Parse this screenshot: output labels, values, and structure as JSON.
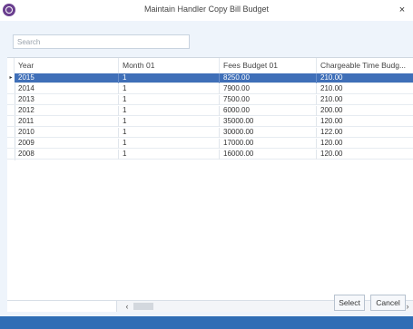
{
  "window": {
    "title": "Maintain Handler Copy Bill Budget",
    "close_glyph": "×",
    "icon": "app-logo-icon"
  },
  "search": {
    "placeholder": "Search",
    "value": ""
  },
  "grid": {
    "columns": [
      "Year",
      "Month 01",
      "Fees Budget 01",
      "Chargeable Time Budg..."
    ],
    "rows": [
      {
        "year": "2015",
        "month": "1",
        "fees": "8250.00",
        "time": "210.00",
        "selected": true
      },
      {
        "year": "2014",
        "month": "1",
        "fees": "7900.00",
        "time": "210.00"
      },
      {
        "year": "2013",
        "month": "1",
        "fees": "7500.00",
        "time": "210.00"
      },
      {
        "year": "2012",
        "month": "1",
        "fees": "6000.00",
        "time": "200.00"
      },
      {
        "year": "2011",
        "month": "1",
        "fees": "35000.00",
        "time": "120.00"
      },
      {
        "year": "2010",
        "month": "1",
        "fees": "30000.00",
        "time": "122.00"
      },
      {
        "year": "2009",
        "month": "1",
        "fees": "17000.00",
        "time": "120.00"
      },
      {
        "year": "2008",
        "month": "1",
        "fees": "16000.00",
        "time": "120.00"
      }
    ],
    "row_indicator": "▸"
  },
  "scroll": {
    "left_glyph": "‹",
    "right_glyph": "›"
  },
  "buttons": {
    "select": "Select",
    "cancel": "Cancel"
  },
  "colors": {
    "selection": "#3f6fb8",
    "footer": "#2f6db5",
    "panel": "#eef4fb"
  }
}
